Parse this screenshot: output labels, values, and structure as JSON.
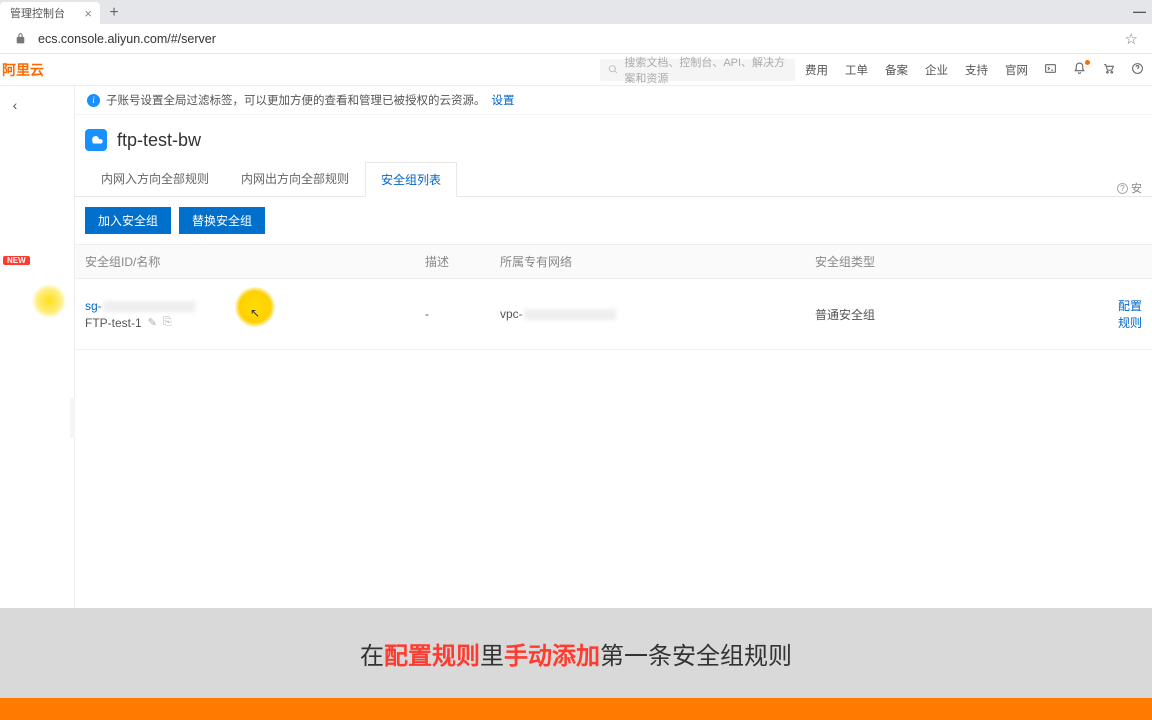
{
  "browser": {
    "tab_title": "管理控制台",
    "url": "ecs.console.aliyun.com/#/server"
  },
  "top_bar": {
    "logo": "阿里云",
    "search_placeholder": "搜索文档、控制台、API、解决方案和资源",
    "links": [
      "费用",
      "工单",
      "备案",
      "企业",
      "支持",
      "官网"
    ]
  },
  "info_bar": {
    "text": "子账号设置全局过滤标签，可以更加方便的查看和管理已被授权的云资源。",
    "link": "设置"
  },
  "header": {
    "title": "ftp-test-bw"
  },
  "tabs": {
    "items": [
      "内网入方向全部规则",
      "内网出方向全部规则",
      "安全组列表"
    ],
    "active": 2,
    "help_label": "安"
  },
  "buttons": {
    "join": "加入安全组",
    "replace": "替换安全组"
  },
  "table": {
    "headers": {
      "col1": "安全组ID/名称",
      "col2": "描述",
      "col3": "所属专有网络",
      "col4": "安全组类型",
      "col5": ""
    },
    "rows": [
      {
        "id_prefix": "sg-",
        "name": "FTP-test-1",
        "desc": "-",
        "vpc_prefix": "vpc-",
        "type": "普通安全组",
        "action": "配置规则"
      }
    ]
  },
  "sidebar": {
    "new_badge": "NEW"
  },
  "caption": {
    "p1": "在",
    "r1": "配置规则",
    "p2": "里",
    "r2": "手动添加",
    "p3": "第一条安全组规则"
  }
}
